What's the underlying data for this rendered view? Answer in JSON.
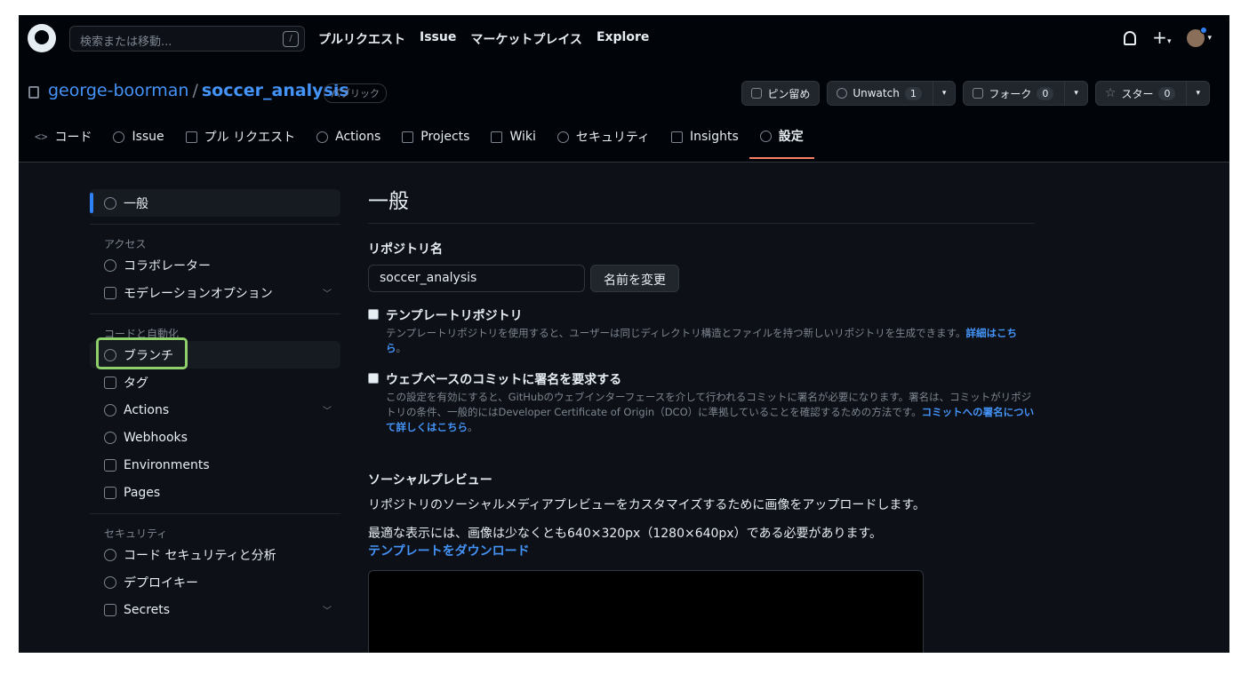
{
  "topbar": {
    "search_placeholder": "検索または移動...",
    "search_kbd": "/",
    "nav": [
      "プルリクエスト",
      "Issue",
      "マーケットプレイス",
      "Explore"
    ]
  },
  "repo": {
    "owner": "george-boorman",
    "separator": "/",
    "name": "soccer_analysis",
    "visibility": "パブリック",
    "pin_label": "ピン留め",
    "watch_label": "Unwatch",
    "watch_count": "1",
    "fork_label": "フォーク",
    "fork_count": "0",
    "star_label": "スター",
    "star_count": "0"
  },
  "tabs": [
    "コード",
    "Issue",
    "プル リクエスト",
    "Actions",
    "Projects",
    "Wiki",
    "セキュリティ",
    "Insights",
    "設定"
  ],
  "sidebar": {
    "general": "一般",
    "access_heading": "アクセス",
    "collaborators": "コラボレーター",
    "moderation": "モデレーションオプション",
    "code_heading": "コードと自動化",
    "branches": "ブランチ",
    "tags": "タグ",
    "actions": "Actions",
    "webhooks": "Webhooks",
    "environments": "Environments",
    "pages": "Pages",
    "security_heading": "セキュリティ",
    "code_security": "コード セキュリティと分析",
    "deploy_keys": "デプロイキー",
    "secrets": "Secrets"
  },
  "main": {
    "title": "一般",
    "repo_name_label": "リポジトリ名",
    "repo_name_value": "soccer_analysis",
    "rename_button": "名前を変更",
    "template_title": "テンプレートリポジトリ",
    "template_desc": "テンプレートリポジトリを使用すると、ユーザーは同じディレクトリ構造とファイルを持つ新しいリポジトリを生成できます。",
    "template_link": "詳細はこちら",
    "template_end": "。",
    "signoff_title": "ウェブベースのコミットに署名を要求する",
    "signoff_desc": "この設定を有効にすると、GitHubのウェブインターフェースを介して行われるコミットに署名が必要になります。署名は、コミットがリポジトリの条件、一般的にはDeveloper Certificate of Origin（DCO）に準拠していることを確認するための方法です。",
    "signoff_link": "コミットへの署名について詳しくはこちら",
    "signoff_end": "。",
    "social_title": "ソーシャルプレビュー",
    "social_desc": "リポジトリのソーシャルメディアプレビューをカスタマイズするために画像をアップロードします。",
    "social_size": "最適な表示には、画像は少なくとも640×320px（1280×640px）である必要があります。",
    "social_link": "テンプレートをダウンロード"
  }
}
